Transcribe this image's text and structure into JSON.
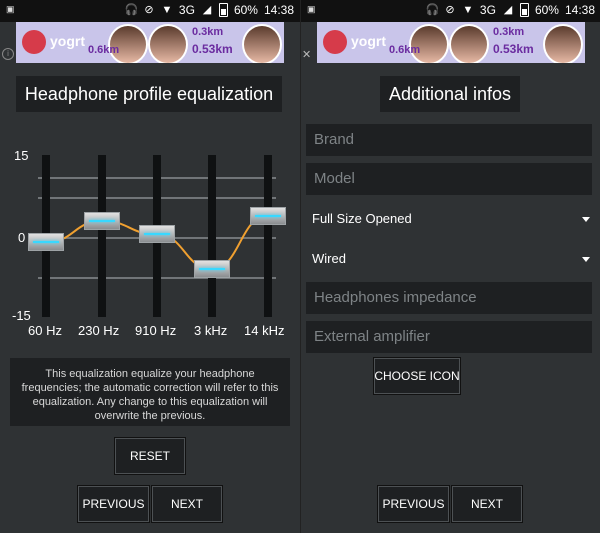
{
  "status": {
    "carrier_icon": "notification-icon",
    "network": "3G",
    "battery": "60%",
    "time": "14:38"
  },
  "ad": {
    "brand": "yogrt",
    "distances": [
      "0.6km",
      "0.3km",
      "0.53km"
    ]
  },
  "left": {
    "header": "Headphone profile equalization",
    "eq": {
      "y_max": "15",
      "y_mid": "0",
      "y_min": "-15",
      "bands": [
        "60 Hz",
        "230 Hz",
        "910 Hz",
        "3 kHz",
        "14 kHz"
      ],
      "gains": [
        -1,
        3,
        0.5,
        -6,
        4
      ]
    },
    "info": "This equalization equalize your headphone frequencies; the automatic correction will refer to this equalization. Any change to this equalization will overwrite the previous.",
    "reset_label": "RESET",
    "previous_label": "PREVIOUS",
    "next_label": "NEXT"
  },
  "right": {
    "header": "Additional infos",
    "brand_placeholder": "Brand",
    "model_placeholder": "Model",
    "size_value": "Full Size Opened",
    "connection_value": "Wired",
    "impedance_placeholder": "Headphones impedance",
    "amplifier_placeholder": "External amplifier",
    "choose_icon_label": "CHOOSE ICON",
    "previous_label": "PREVIOUS",
    "next_label": "NEXT"
  },
  "colors": {
    "accent_curve": "#f0a030",
    "slider_glow": "#38d8ff"
  }
}
